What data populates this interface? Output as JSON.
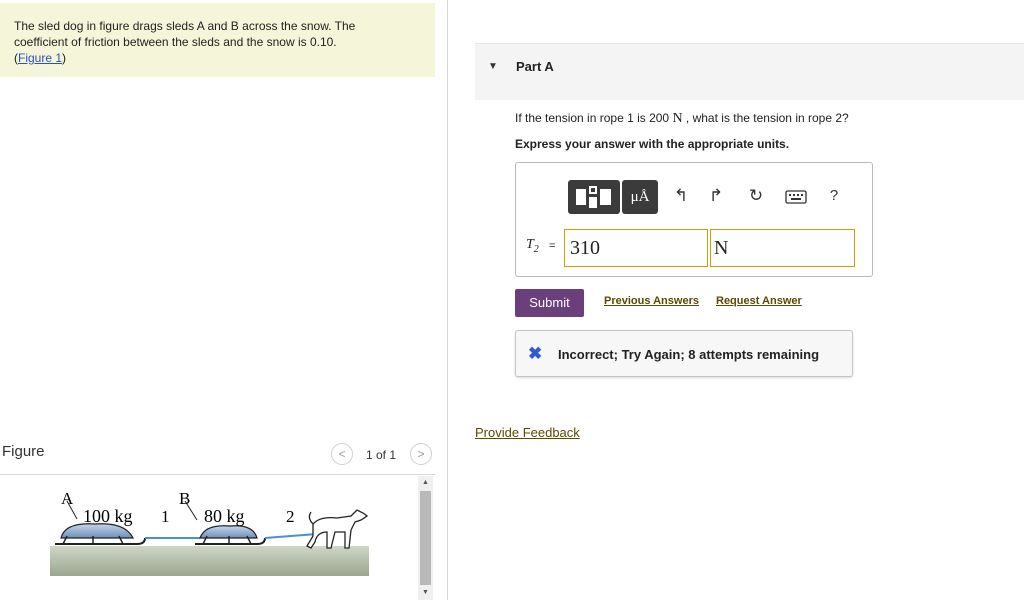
{
  "problem": {
    "line1": "The sled dog in figure drags sleds A and B across the snow. The",
    "line2": "coefficient of friction between the sleds and the snow is 0.10.",
    "figure_link_open": "(",
    "figure_link": "Figure 1",
    "figure_link_close": ")"
  },
  "figure": {
    "label": "Figure",
    "pager_prev": "<",
    "pager_text": "1 of 1",
    "pager_next": ">",
    "sled_a_letter": "A",
    "sled_a_mass": "100 kg",
    "rope1_label": "1",
    "sled_b_letter": "B",
    "sled_b_mass": "80 kg",
    "rope2_label": "2"
  },
  "part": {
    "title": "Part A",
    "question_pre": "If the tension in rope 1 is 200",
    "question_unit": "N",
    "question_post": ", what is the tension in rope 2?",
    "instruction": "Express your answer with the appropriate units."
  },
  "answer": {
    "units_button": "μÅ",
    "help": "?",
    "symbol": "T",
    "symbol_sub": "2",
    "equals": "=",
    "value": "310",
    "unit": "N"
  },
  "actions": {
    "submit": "Submit",
    "previous_answers": "Previous Answers",
    "request_answer": "Request Answer"
  },
  "feedback": {
    "icon": "✖",
    "message": "Incorrect; Try Again; 8 attempts remaining"
  },
  "footer": {
    "provide_feedback": "Provide Feedback"
  },
  "colors": {
    "problem_bg": "#f5f5d9",
    "submit_bg": "#6b3f7c",
    "link": "#5b4a00",
    "error_icon": "#2f5bd6",
    "input_border": "#c8a000"
  },
  "icons": [
    "templates-icon",
    "units-icon",
    "undo-icon",
    "redo-icon",
    "reset-icon",
    "keyboard-icon",
    "help-icon",
    "incorrect-x-icon",
    "caret-down-icon"
  ]
}
